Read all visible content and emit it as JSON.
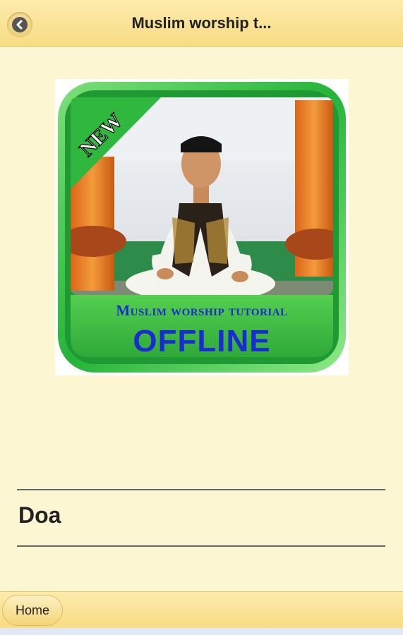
{
  "header": {
    "title": "Muslim worship t..."
  },
  "hero": {
    "badge": "NEW",
    "banner_line1": "Muslim worship tutorial",
    "banner_line2": "OFFLINE"
  },
  "list": {
    "items": [
      {
        "label": "Doa"
      }
    ]
  },
  "footer": {
    "home_label": "Home"
  },
  "colors": {
    "bar": "#f8dc83",
    "page_background": "#fdf6d3",
    "hero_green": "#2cb63d",
    "banner_text": "#1a2bd1"
  }
}
